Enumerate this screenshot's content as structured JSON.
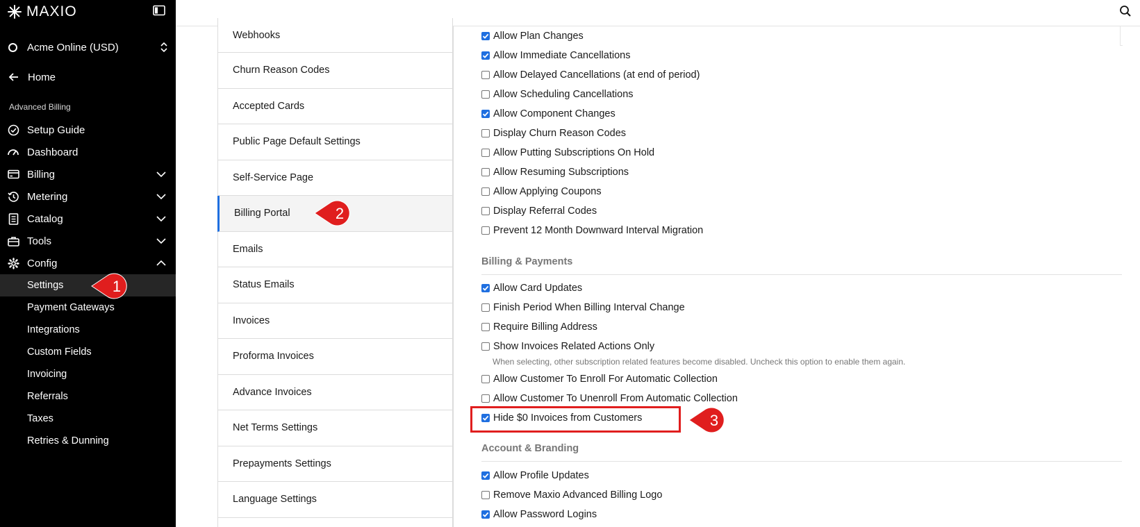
{
  "sidebar": {
    "brand": "MAXIO",
    "account": "Acme Online (USD)",
    "home": "Home",
    "section": "Advanced Billing",
    "items": [
      {
        "label": "Setup Guide",
        "icon": "check-circle-icon",
        "chevron": "none"
      },
      {
        "label": "Dashboard",
        "icon": "gauge-icon",
        "chevron": "none"
      },
      {
        "label": "Billing",
        "icon": "card-icon",
        "chevron": "down"
      },
      {
        "label": "Metering",
        "icon": "history-icon",
        "chevron": "down"
      },
      {
        "label": "Catalog",
        "icon": "catalog-icon",
        "chevron": "down"
      },
      {
        "label": "Tools",
        "icon": "briefcase-icon",
        "chevron": "down"
      },
      {
        "label": "Config",
        "icon": "gear-icon",
        "chevron": "up"
      }
    ],
    "sub_items": [
      "Settings",
      "Payment Gateways",
      "Integrations",
      "Custom Fields",
      "Invoicing",
      "Referrals",
      "Taxes",
      "Retries & Dunning"
    ]
  },
  "settings_menu": [
    "Webhooks",
    "Churn Reason Codes",
    "Accepted Cards",
    "Public Page Default Settings",
    "Self-Service Page",
    "Billing Portal",
    "Emails",
    "Status Emails",
    "Invoices",
    "Proforma Invoices",
    "Advance Invoices",
    "Net Terms Settings",
    "Prepayments Settings",
    "Language Settings"
  ],
  "options_top": [
    {
      "label": "Allow Plan Changes",
      "checked": true
    },
    {
      "label": "Allow Immediate Cancellations",
      "checked": true
    },
    {
      "label": "Allow Delayed Cancellations (at end of period)",
      "checked": false
    },
    {
      "label": "Allow Scheduling Cancellations",
      "checked": false
    },
    {
      "label": "Allow Component Changes",
      "checked": true
    },
    {
      "label": "Display Churn Reason Codes",
      "checked": false
    },
    {
      "label": "Allow Putting Subscriptions On Hold",
      "checked": false
    },
    {
      "label": "Allow Resuming Subscriptions",
      "checked": false
    },
    {
      "label": "Allow Applying Coupons",
      "checked": false
    },
    {
      "label": "Display Referral Codes",
      "checked": false
    },
    {
      "label": "Prevent 12 Month Downward Interval Migration",
      "checked": false
    }
  ],
  "billing_payments": {
    "heading": "Billing & Payments",
    "options": [
      {
        "label": "Allow Card Updates",
        "checked": true
      },
      {
        "label": "Finish Period When Billing Interval Change",
        "checked": false
      },
      {
        "label": "Require Billing Address",
        "checked": false
      },
      {
        "label": "Show Invoices Related Actions Only",
        "checked": false
      },
      {
        "label": "Allow Customer To Enroll For Automatic Collection",
        "checked": false
      },
      {
        "label": "Allow Customer To Unenroll From Automatic Collection",
        "checked": false
      },
      {
        "label": "Hide $0 Invoices from Customers",
        "checked": true
      }
    ],
    "hint": "When selecting, other subscription related features become disabled. Uncheck this option to enable them again."
  },
  "account_branding": {
    "heading": "Account & Branding",
    "options": [
      {
        "label": "Allow Profile Updates",
        "checked": true
      },
      {
        "label": "Remove Maxio Advanced Billing Logo",
        "checked": false
      },
      {
        "label": "Allow Password Logins",
        "checked": true
      }
    ]
  },
  "annotations": [
    "1",
    "2",
    "3"
  ],
  "colors": {
    "accent": "#1f6fe0",
    "callout": "#e01e1e",
    "sidebar_bg": "#000000"
  }
}
